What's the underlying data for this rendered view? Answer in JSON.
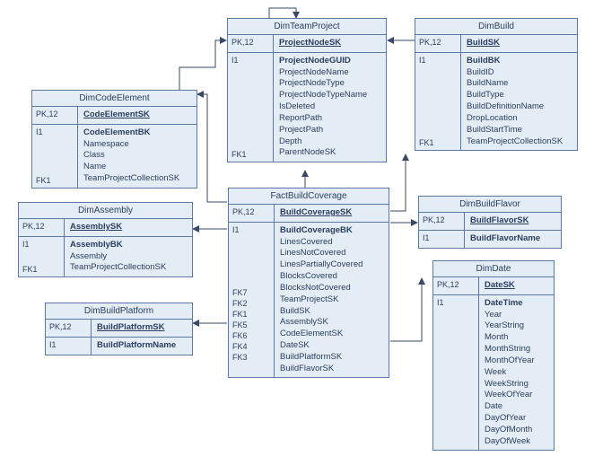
{
  "entities": {
    "dimCodeElement": {
      "title": "DimCodeElement",
      "pkLabel": "PK,12",
      "pk": "CodeElementSK",
      "col2Label": "I1",
      "bk": "CodeElementBK",
      "fkLabel": "FK1",
      "attrs": [
        "Namespace",
        "Class",
        "Name",
        "TeamProjectCollectionSK"
      ]
    },
    "dimAssembly": {
      "title": "DimAssembly",
      "pkLabel": "PK,12",
      "pk": "AssemblySK",
      "col2Label": "I1",
      "bk": "AssemblyBK",
      "fkLabel": "FK1",
      "attrs": [
        "Assembly",
        "TeamProjectCollectionSK"
      ]
    },
    "dimBuildPlatform": {
      "title": "DimBuildPlatform",
      "pkLabel": "PK,12",
      "pk": "BuildPlatformSK",
      "col2Label": "I1",
      "attr": "BuildPlatformName"
    },
    "dimTeamProject": {
      "title": "DimTeamProject",
      "pkLabel": "PK,12",
      "pk": "ProjectNodeSK",
      "col2Label": "I1",
      "bk": "ProjectNodeGUID",
      "fkLabel": "FK1",
      "attrs": [
        "ProjectNodeName",
        "ProjectNodeType",
        "ProjectNodeTypeName",
        "IsDeleted",
        "ReportPath",
        "ProjectPath",
        "Depth",
        "ParentNodeSK"
      ]
    },
    "factBuildCoverage": {
      "title": "FactBuildCoverage",
      "pkLabel": "PK,12",
      "pk": "BuildCoverageSK",
      "col2Label": "I1",
      "bk": "BuildCoverageBK",
      "fkLabels": [
        "FK7",
        "FK2",
        "FK1",
        "FK5",
        "FK6",
        "FK4",
        "FK3"
      ],
      "attrs": [
        "LinesCovered",
        "LinesNotCovered",
        "LinesPartiallyCovered",
        "BlocksCovered",
        "BlocksNotCovered",
        "TeamProjectSK",
        "BuildSK",
        "AssemblySK",
        "CodeElementSK",
        "DateSK",
        "BuildPlatformSK",
        "BuildFlavorSK"
      ]
    },
    "dimBuild": {
      "title": "DimBuild",
      "pkLabel": "PK,12",
      "pk": "BuildSK",
      "col2Label": "I1",
      "bk": "BuildBK",
      "fkLabel": "FK1",
      "attrs": [
        "BuildID",
        "BuildName",
        "BuildType",
        "BuildDefinitionName",
        "DropLocation",
        "BuildStartTime",
        "TeamProjectCollectionSK"
      ]
    },
    "dimBuildFlavor": {
      "title": "DimBuildFlavor",
      "pkLabel": "PK,12",
      "pk": "BuildFlavorSK",
      "col2Label": "I1",
      "attr": "BuildFlavorName"
    },
    "dimDate": {
      "title": "DimDate",
      "pkLabel": "PK,12",
      "pk": "DateSK",
      "col2Label": "I1",
      "bk": "DateTime",
      "attrs": [
        "Year",
        "YearString",
        "Month",
        "MonthString",
        "MonthOfYear",
        "Week",
        "WeekString",
        "WeekOfYear",
        "Date",
        "DayOfYear",
        "DayOfMonth",
        "DayOfWeek"
      ]
    }
  },
  "chart_data": {
    "type": "table",
    "title": "Entity-Relationship Diagram (Build Coverage Star Schema)",
    "entities": [
      {
        "name": "DimCodeElement",
        "pk": "CodeElementSK",
        "columns": [
          "CodeElementBK",
          "Namespace",
          "Class",
          "Name",
          "TeamProjectCollectionSK"
        ]
      },
      {
        "name": "DimAssembly",
        "pk": "AssemblySK",
        "columns": [
          "AssemblyBK",
          "Assembly",
          "TeamProjectCollectionSK"
        ]
      },
      {
        "name": "DimBuildPlatform",
        "pk": "BuildPlatformSK",
        "columns": [
          "BuildPlatformName"
        ]
      },
      {
        "name": "DimTeamProject",
        "pk": "ProjectNodeSK",
        "columns": [
          "ProjectNodeGUID",
          "ProjectNodeName",
          "ProjectNodeType",
          "ProjectNodeTypeName",
          "IsDeleted",
          "ReportPath",
          "ProjectPath",
          "Depth",
          "ParentNodeSK"
        ]
      },
      {
        "name": "FactBuildCoverage",
        "pk": "BuildCoverageSK",
        "columns": [
          "BuildCoverageBK",
          "LinesCovered",
          "LinesNotCovered",
          "LinesPartiallyCovered",
          "BlocksCovered",
          "BlocksNotCovered",
          "TeamProjectSK",
          "BuildSK",
          "AssemblySK",
          "CodeElementSK",
          "DateSK",
          "BuildPlatformSK",
          "BuildFlavorSK"
        ]
      },
      {
        "name": "DimBuild",
        "pk": "BuildSK",
        "columns": [
          "BuildBK",
          "BuildID",
          "BuildName",
          "BuildType",
          "BuildDefinitionName",
          "DropLocation",
          "BuildStartTime",
          "TeamProjectCollectionSK"
        ]
      },
      {
        "name": "DimBuildFlavor",
        "pk": "BuildFlavorSK",
        "columns": [
          "BuildFlavorName"
        ]
      },
      {
        "name": "DimDate",
        "pk": "DateSK",
        "columns": [
          "DateTime",
          "Year",
          "YearString",
          "Month",
          "MonthString",
          "MonthOfYear",
          "Week",
          "WeekString",
          "WeekOfYear",
          "Date",
          "DayOfYear",
          "DayOfMonth",
          "DayOfWeek"
        ]
      }
    ],
    "relationships": [
      {
        "from": "FactBuildCoverage",
        "to": "DimTeamProject",
        "fk": "TeamProjectSK"
      },
      {
        "from": "FactBuildCoverage",
        "to": "DimBuild",
        "fk": "BuildSK"
      },
      {
        "from": "FactBuildCoverage",
        "to": "DimAssembly",
        "fk": "AssemblySK"
      },
      {
        "from": "FactBuildCoverage",
        "to": "DimCodeElement",
        "fk": "CodeElementSK"
      },
      {
        "from": "FactBuildCoverage",
        "to": "DimDate",
        "fk": "DateSK"
      },
      {
        "from": "FactBuildCoverage",
        "to": "DimBuildPlatform",
        "fk": "BuildPlatformSK"
      },
      {
        "from": "FactBuildCoverage",
        "to": "DimBuildFlavor",
        "fk": "BuildFlavorSK"
      },
      {
        "from": "DimTeamProject",
        "to": "DimTeamProject",
        "fk": "ParentNodeSK (self)"
      },
      {
        "from": "DimBuild",
        "to": "DimTeamProject",
        "fk": "TeamProjectCollectionSK"
      }
    ]
  }
}
